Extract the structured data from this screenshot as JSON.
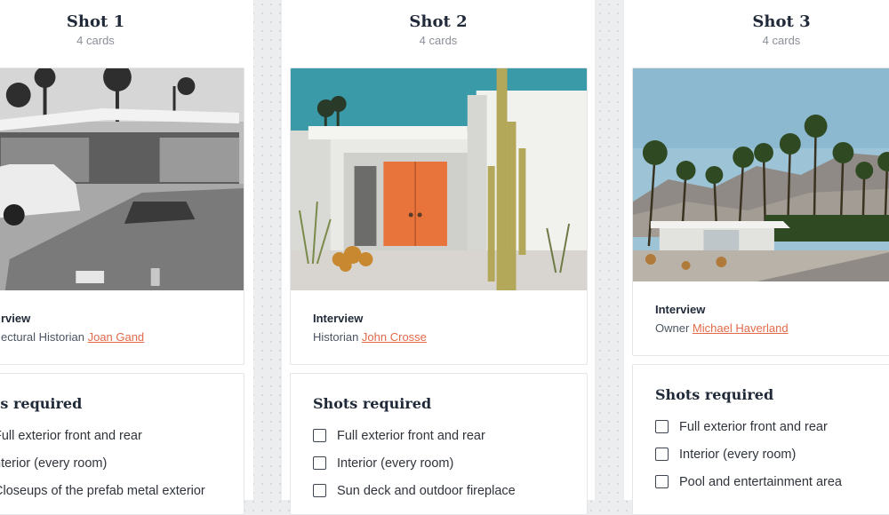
{
  "columns": [
    {
      "title": "Shot 1",
      "count": "4 cards",
      "interview": {
        "type": "rview",
        "role": "ectural Historian",
        "name": "Joan Gand"
      },
      "shots": {
        "title": "ts required",
        "items": [
          "Full exterior front and rear",
          "nterior (every room)",
          "Closeups of the prefab metal exterior"
        ]
      }
    },
    {
      "title": "Shot 2",
      "count": "4 cards",
      "interview": {
        "type": "Interview",
        "role": "Historian",
        "name": "John Crosse"
      },
      "shots": {
        "title": "Shots required",
        "items": [
          "Full exterior front and rear",
          "Interior (every room)",
          "Sun deck and outdoor fireplace"
        ]
      }
    },
    {
      "title": "Shot 3",
      "count": "4 cards",
      "interview": {
        "type": "Interview",
        "role": "Owner",
        "name": "Michael Haverland"
      },
      "shots": {
        "title": "Shots required",
        "items": [
          "Full exterior front and rear",
          "Interior (every room)",
          "Pool and entertainment area"
        ]
      }
    }
  ],
  "colors": {
    "link": "#e26a4a",
    "door": "#e8743b",
    "sky": "#3a9aa8",
    "board": "#ecedef"
  }
}
